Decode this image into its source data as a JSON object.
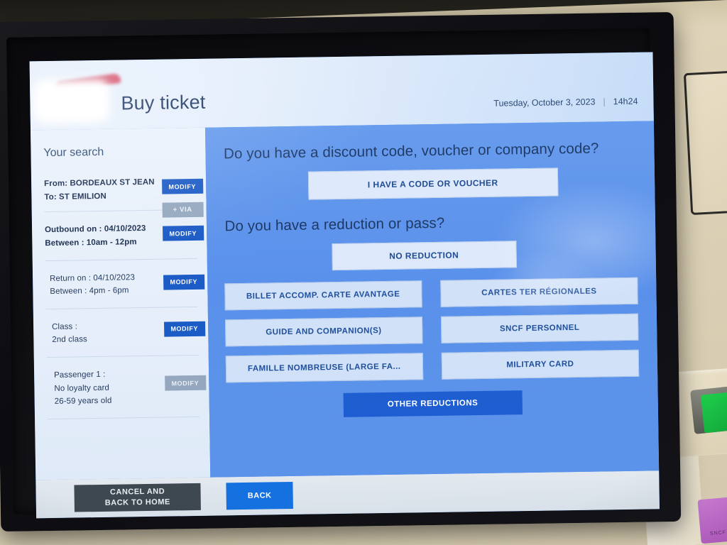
{
  "header": {
    "title": "Buy ticket",
    "date": "Tuesday, October 3, 2023",
    "separator": "|",
    "time": "14h24",
    "logo_name": "sncf-logo"
  },
  "sidebar": {
    "title": "Your search",
    "sections": [
      {
        "name": "route",
        "lines": [
          "From: BORDEAUX ST JEAN",
          "To: ST EMILION"
        ],
        "modify_label": "MODIFY",
        "via_label": "+ VIA"
      },
      {
        "name": "outbound",
        "lines": [
          "Outbound on : 04/10/2023",
          "Between : 10am - 12pm"
        ],
        "modify_label": "MODIFY"
      },
      {
        "name": "return",
        "lines": [
          "Return on : 04/10/2023",
          "Between : 4pm - 6pm"
        ],
        "modify_label": "MODIFY"
      },
      {
        "name": "class",
        "lines": [
          "Class :",
          "2nd class"
        ],
        "modify_label": "MODIFY"
      },
      {
        "name": "passenger",
        "lines": [
          "Passenger 1 :",
          "No loyalty card",
          "26-59 years old"
        ],
        "modify_label": "MODIFY"
      }
    ]
  },
  "main": {
    "question_discount": "Do you have a discount code, voucher or company code?",
    "voucher_button": "I HAVE A CODE OR VOUCHER",
    "question_reduction": "Do you have a reduction or pass?",
    "no_reduction_button": "NO REDUCTION",
    "reduction_options": [
      "BILLET ACCOMP. CARTE AVANTAGE",
      "CARTES TER RÉGIONALES",
      "GUIDE AND COMPANION(S)",
      "SNCF PERSONNEL",
      "FAMILLE NOMBREUSE (LARGE FA...",
      "MILITARY CARD"
    ],
    "other_reductions_button": "OTHER REDUCTIONS"
  },
  "footer": {
    "cancel_line1": "CANCEL AND",
    "cancel_line2": "BACK TO HOME",
    "back_label": "BACK"
  },
  "hardware": {
    "magenta_label": "SNCF"
  },
  "colors": {
    "accent_blue": "#1657c4",
    "main_blue": "#5b93ea",
    "muted_gray": "#93a6be",
    "dark_button": "#3d4750",
    "card_green": "#1fcf4c"
  }
}
